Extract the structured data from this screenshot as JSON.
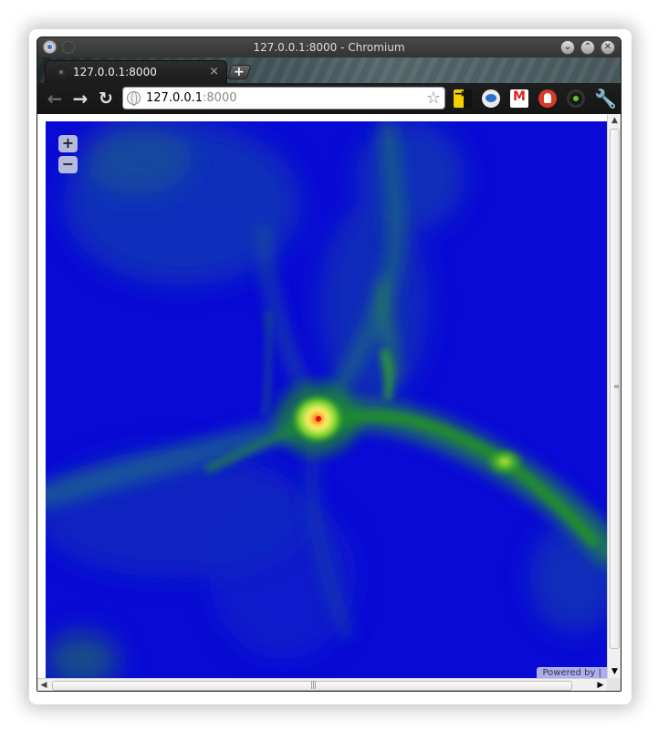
{
  "window": {
    "title": "127.0.0.1:8000 - Chromium",
    "controls": {
      "minimize": "⌄",
      "maximize": "⌃",
      "close": "✕"
    }
  },
  "tabs": [
    {
      "title": "127.0.0.1:8000",
      "close": "×",
      "active": true
    }
  ],
  "new_tab_label": "+",
  "toolbar": {
    "back": "←",
    "forward": "→",
    "reload": "↻",
    "url_host": "127.0.0.1",
    "url_port": ":8000",
    "bookmark_star": "☆",
    "wrench": "🔧"
  },
  "extensions": [
    "sidebar-extension-icon",
    "messaging-extension-icon",
    "gmail-icon",
    "adblock-icon",
    "headphones-icon"
  ],
  "map": {
    "zoom_in": "+",
    "zoom_out": "−",
    "attribution": "Powered by |",
    "colors": {
      "background": "#0a0ad6",
      "low": "#1030c0",
      "mid": "#1e8a2a",
      "high": "#6fd02a",
      "peak_yellow": "#fff36a",
      "peak_red": "#e01010"
    }
  },
  "scrollbars": {
    "up": "▲",
    "down": "▼",
    "left": "◀",
    "right": "▶",
    "vertical_grip": "≡",
    "horizontal_grip": "|||"
  }
}
